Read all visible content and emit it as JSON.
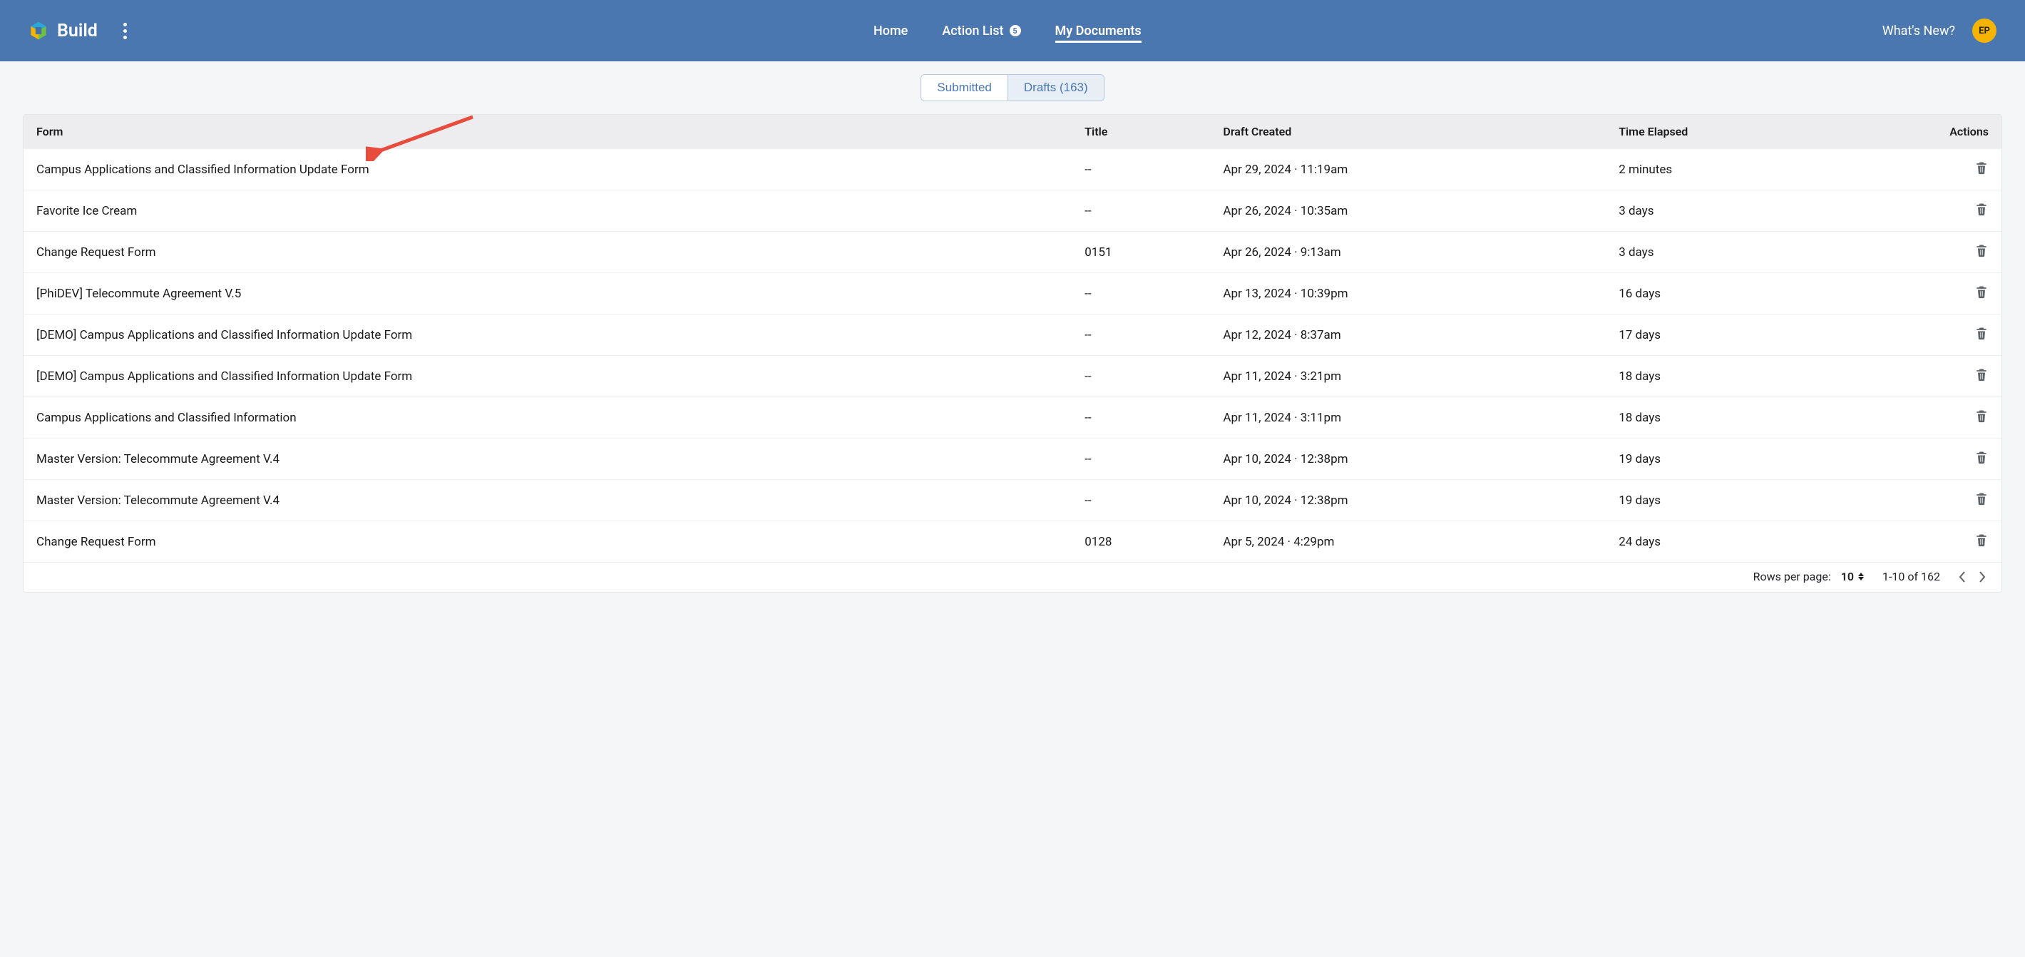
{
  "app": {
    "name": "Build"
  },
  "nav": {
    "home": "Home",
    "action_list": "Action List",
    "action_badge": "5",
    "my_documents": "My Documents",
    "whats_new": "What's New?"
  },
  "user": {
    "initials": "EP"
  },
  "segmented": {
    "submitted": "Submitted",
    "drafts": "Drafts (163)"
  },
  "table": {
    "headers": {
      "form": "Form",
      "title": "Title",
      "created": "Draft Created",
      "elapsed": "Time Elapsed",
      "actions": "Actions"
    },
    "rows": [
      {
        "form": "Campus Applications and Classified Information Update Form",
        "title": "--",
        "created": "Apr 29, 2024 · 11:19am",
        "elapsed": "2 minutes"
      },
      {
        "form": "Favorite Ice Cream",
        "title": "--",
        "created": "Apr 26, 2024 · 10:35am",
        "elapsed": "3 days"
      },
      {
        "form": "Change Request Form",
        "title": "0151",
        "created": "Apr 26, 2024 · 9:13am",
        "elapsed": "3 days"
      },
      {
        "form": "[PhiDEV] Telecommute Agreement V.5",
        "title": "--",
        "created": "Apr 13, 2024 · 10:39pm",
        "elapsed": "16 days"
      },
      {
        "form": "[DEMO] Campus Applications and Classified Information Update Form",
        "title": "--",
        "created": "Apr 12, 2024 · 8:37am",
        "elapsed": "17 days"
      },
      {
        "form": "[DEMO] Campus Applications and Classified Information Update Form",
        "title": "--",
        "created": "Apr 11, 2024 · 3:21pm",
        "elapsed": "18 days"
      },
      {
        "form": "Campus Applications and Classified Information",
        "title": "--",
        "created": "Apr 11, 2024 · 3:11pm",
        "elapsed": "18 days"
      },
      {
        "form": "Master Version: Telecommute Agreement V.4",
        "title": "--",
        "created": "Apr 10, 2024 · 12:38pm",
        "elapsed": "19 days"
      },
      {
        "form": "Master Version: Telecommute Agreement V.4",
        "title": "--",
        "created": "Apr 10, 2024 · 12:38pm",
        "elapsed": "19 days"
      },
      {
        "form": "Change Request Form",
        "title": "0128",
        "created": "Apr 5, 2024 · 4:29pm",
        "elapsed": "24 days"
      }
    ]
  },
  "pagination": {
    "rpp_label": "Rows per page:",
    "rpp_value": "10",
    "range": "1-10 of 162"
  }
}
